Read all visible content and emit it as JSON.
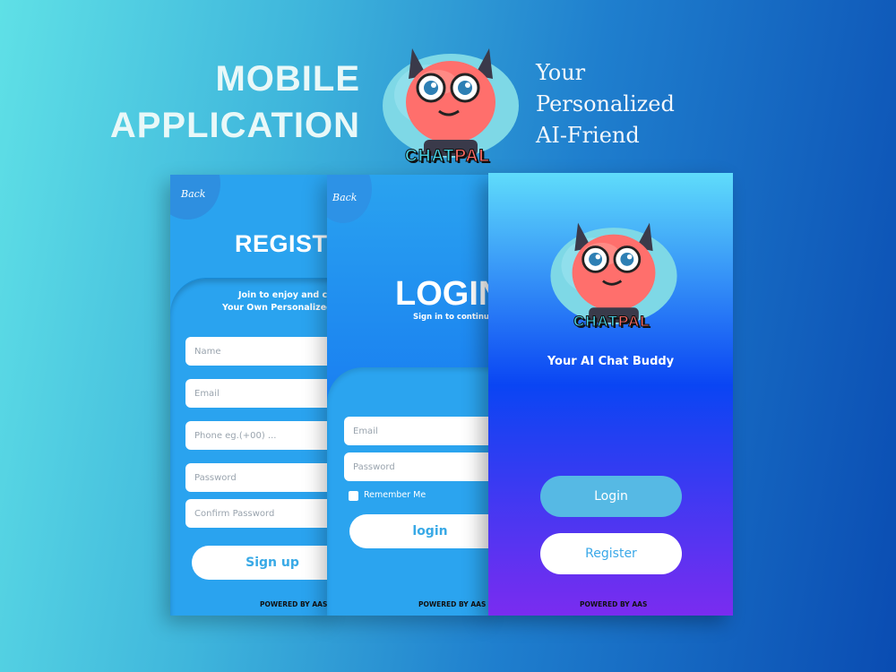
{
  "hero": {
    "title_line1": "MOBILE",
    "title_line2": "APPLICATION",
    "tagline_line1": "Your",
    "tagline_line2": "Personalized",
    "tagline_line3": "AI-Friend"
  },
  "logo": {
    "name_part1": "CHAT",
    "name_part2": "PAL",
    "icon": "robot-mascot-icon"
  },
  "register_screen": {
    "back_label": "Back",
    "title": "REGISTE",
    "blurb_line1": "Join to enjoy and cre",
    "blurb_line2": "Your Own Personalized A",
    "fields": {
      "name": "Name",
      "email": "Email",
      "phone": "Phone eg.(+00) ...",
      "password": "Password",
      "confirm": "Confirm Password"
    },
    "signup_label": "Sign up",
    "powered": "POWERED BY AAS"
  },
  "login_screen": {
    "back_label": "Back",
    "title": "LOGIN",
    "subtitle": "Sign in to continue",
    "fields": {
      "email": "Email",
      "password": "Password"
    },
    "remember_label": "Remember Me",
    "login_label": "login",
    "powered": "POWERED BY AAS"
  },
  "splash_screen": {
    "subtitle": "Your AI Chat Buddy",
    "login_label": "Login",
    "register_label": "Register",
    "powered": "POWERED BY AAS"
  },
  "colors": {
    "accent": "#2aa3ef",
    "splash_top": "#5fdcfb",
    "splash_mid": "#0a45f3",
    "splash_bottom": "#7a2cf0",
    "logo_cyan": "#49d6e9",
    "logo_red": "#ff6a64"
  }
}
